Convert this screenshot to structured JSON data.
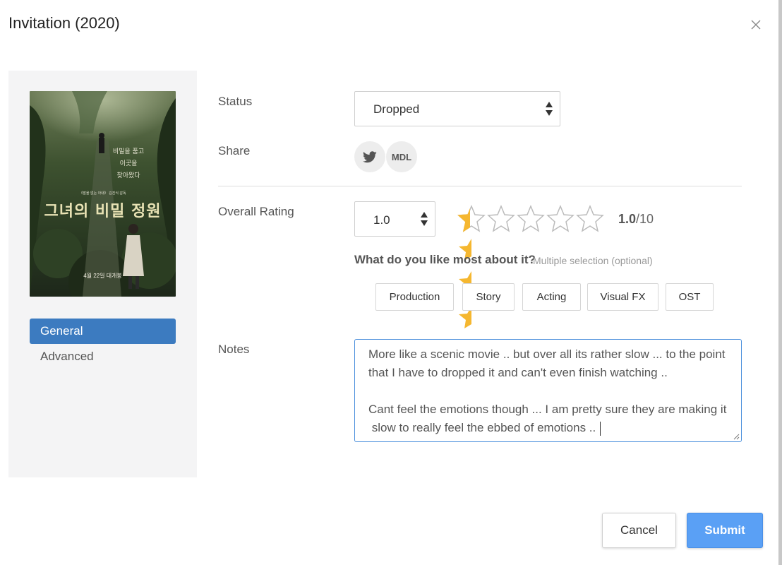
{
  "modal": {
    "title": "Invitation (2020)"
  },
  "poster": {
    "tagline_lines": [
      "비밀을 품고",
      "이곳을",
      "찾아왔다"
    ],
    "credit": "《말을 없는 아내》 김진식 감독",
    "title_ko": "그녀의 비밀 정원",
    "release": "4월 22일 대개봉"
  },
  "nav": {
    "items": [
      {
        "label": "General",
        "active": true
      },
      {
        "label": "Advanced",
        "active": false
      }
    ]
  },
  "form": {
    "status": {
      "label": "Status",
      "value": "Dropped"
    },
    "share": {
      "label": "Share",
      "buttons": [
        {
          "icon": "twitter-icon"
        },
        {
          "label": "MDL"
        }
      ]
    },
    "rating": {
      "label": "Overall Rating",
      "value": "1.0",
      "readout_value": "1.0",
      "readout_max": "/10",
      "stars_total": 5,
      "stars_filled": 0.5,
      "star_color": "#f5b730"
    },
    "likes": {
      "question": "What do you like most about it?",
      "hint": "Multiple selection (optional)",
      "options": [
        "Production",
        "Story",
        "Acting",
        "Visual FX",
        "OST"
      ]
    },
    "notes": {
      "label": "Notes",
      "lines": [
        "More like a scenic movie .. but over all its rather slow ... to the point",
        "that I have to dropped it and can't even finish watching ..",
        "",
        "Cant feel the emotions though ... I am pretty sure they are making it",
        " slow to really feel the ebbed of emotions .."
      ]
    }
  },
  "actions": {
    "cancel": "Cancel",
    "submit": "Submit"
  },
  "colors": {
    "accent": "#3c7bc0",
    "submit": "#5aa0f5",
    "star": "#f5b730",
    "focus": "#4a8fdc"
  }
}
